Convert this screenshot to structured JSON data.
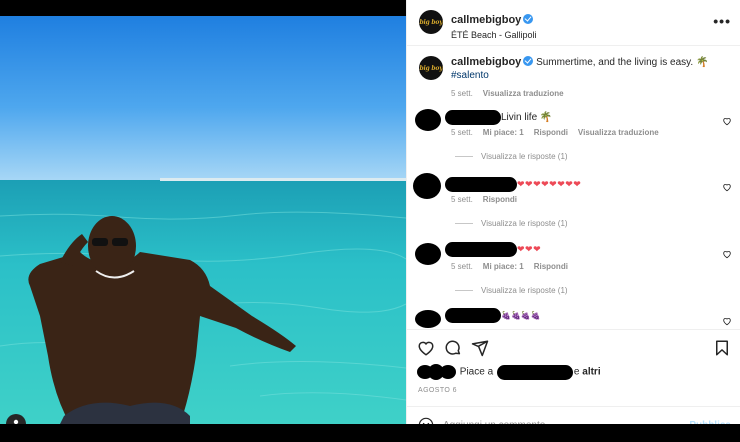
{
  "post": {
    "username": "callmebigboy",
    "location": "ÉTÉ Beach - Gallipoli",
    "avatar_logo": "big boy",
    "more_label": "•••"
  },
  "caption": {
    "username": "callmebigboy",
    "text": "Summertime, and the living is easy. 🌴",
    "hashtag": "#salento",
    "time": "5 sett.",
    "translate": "Visualizza traduzione"
  },
  "comments": [
    {
      "text": "Livin life 🌴",
      "time": "5 sett.",
      "likes": "Mi piace: 1",
      "reply": "Rispondi",
      "translate": "Visualizza traduzione",
      "replies": "Visualizza le risposte (1)"
    },
    {
      "text": "❤❤❤❤❤❤❤❤",
      "time": "5 sett.",
      "reply": "Rispondi",
      "replies": "Visualizza le risposte (1)"
    },
    {
      "text": "❤❤❤",
      "time": "5 sett.",
      "likes": "Mi piace: 1",
      "reply": "Rispondi",
      "replies": "Visualizza le risposte (1)"
    },
    {
      "text": "🍇🍇🍇🍇"
    }
  ],
  "likes": {
    "prefix": "Piace a",
    "conj": "e",
    "others": "altri"
  },
  "date": "AGOSTO 6",
  "add_comment": {
    "placeholder": "Aggiungi un commento...",
    "publish": "Pubblica"
  },
  "icons": {
    "like": "heart-icon",
    "comment": "comment-icon",
    "share": "paper-plane-icon",
    "save": "bookmark-icon",
    "emoji": "emoji-icon",
    "tagged_user": "user-icon"
  },
  "colors": {
    "hashtag": "#00376b",
    "muted": "#8e8e8e",
    "publish_disabled": "#b2dffc",
    "verified": "#3897f0",
    "heart": "#ed4956"
  }
}
